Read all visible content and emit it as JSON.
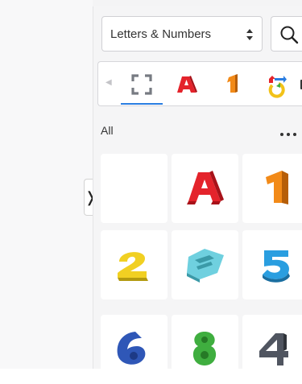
{
  "library": {
    "category_select": {
      "value": "Letters & Numbers"
    },
    "tabs": [
      {
        "name": "all-shapes",
        "icon": "dashed-frame-icon"
      },
      {
        "name": "letters",
        "icon": "letter-a-icon",
        "color": "#e4232b"
      },
      {
        "name": "numbers",
        "icon": "number-1-icon",
        "color": "#f28a18"
      },
      {
        "name": "symbols",
        "icon": "refresh-arrows-icon"
      }
    ],
    "active_tab_index": 0,
    "section_label": "All",
    "tiles": [
      {
        "name": "blank",
        "color": null
      },
      {
        "name": "letter-a",
        "glyph": "A",
        "color": "#e4232b"
      },
      {
        "name": "number-1",
        "glyph": "1",
        "color": "#f28a18"
      },
      {
        "name": "number-2",
        "glyph": "2",
        "color": "#f1d022"
      },
      {
        "name": "number-3",
        "glyph": "3",
        "color": "#6fd0df"
      },
      {
        "name": "number-5",
        "glyph": "5",
        "color": "#2a9ee0"
      },
      {
        "name": "number-6",
        "glyph": "6",
        "color": "#2f57b7"
      },
      {
        "name": "number-8",
        "glyph": "8",
        "color": "#3fae3f"
      },
      {
        "name": "number-4",
        "glyph": "4",
        "color": "#505560"
      }
    ]
  },
  "colors": {
    "accent": "#2a7de1",
    "panel_bg": "#f5f5f6",
    "tile_bg": "#ffffff"
  }
}
